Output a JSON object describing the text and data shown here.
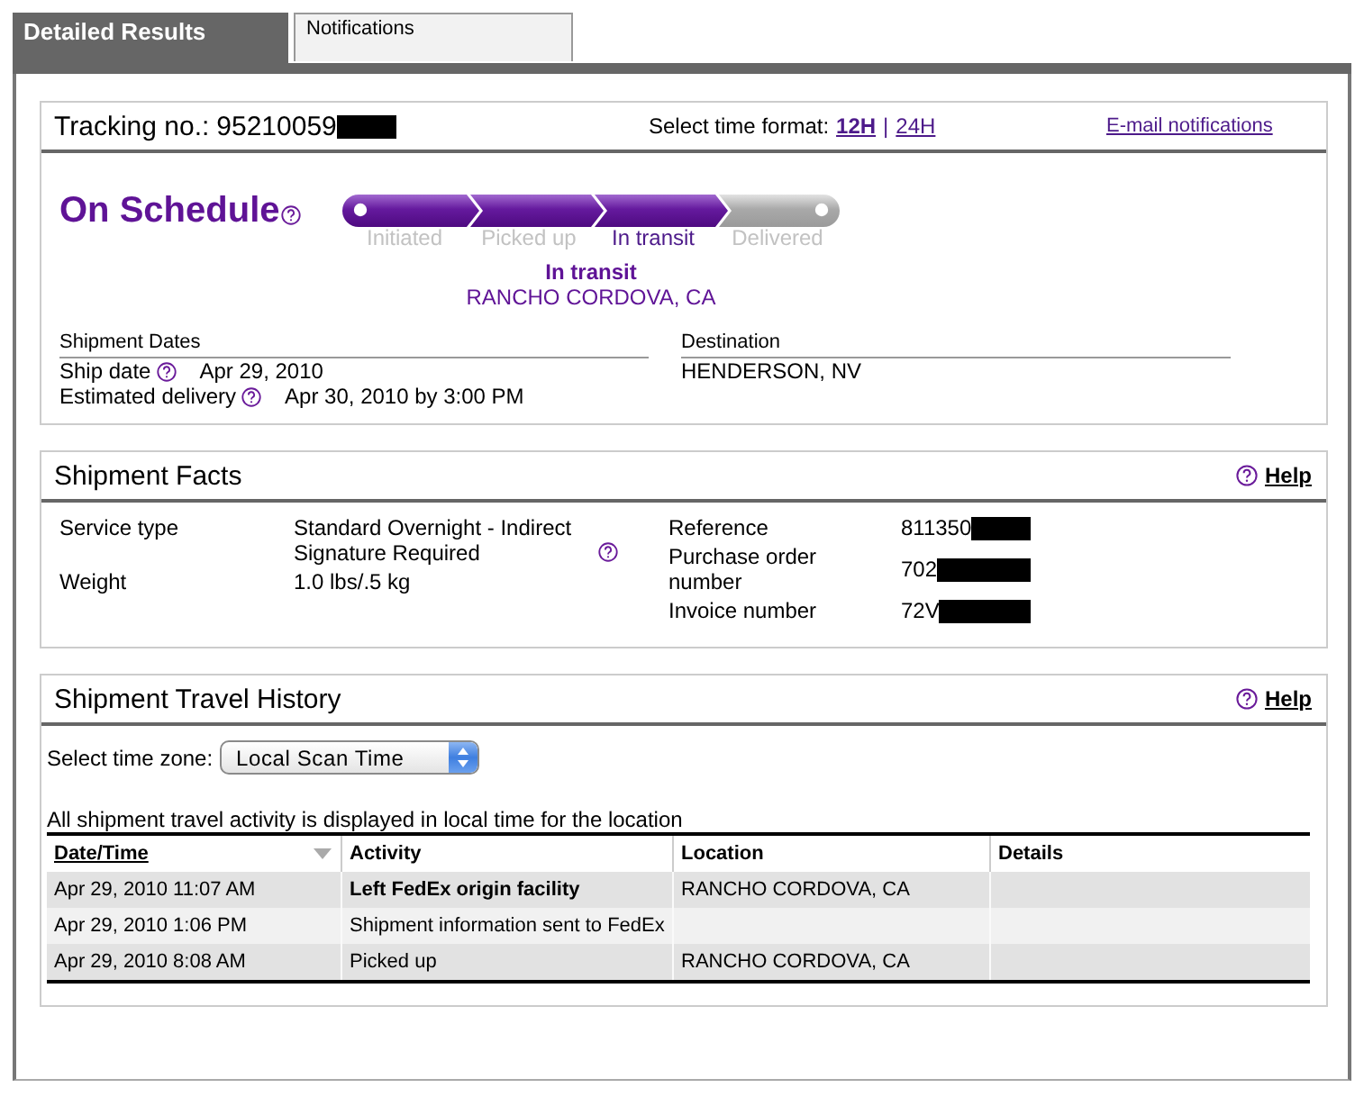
{
  "tabs": [
    {
      "label": "Detailed Results",
      "selected": true
    },
    {
      "label": "Notifications",
      "selected": false
    }
  ],
  "tracking": {
    "label": "Tracking no.:",
    "number": "95210059",
    "redacted": true,
    "time_format": {
      "label": "Select time format:",
      "options": [
        {
          "label": "12H",
          "selected": true
        },
        {
          "label": "24H",
          "selected": false
        }
      ],
      "separator": "|"
    },
    "email_link": "E-mail notifications"
  },
  "status": {
    "title": "On Schedule",
    "help": true,
    "steps": [
      {
        "label": "Initiated",
        "completed": true,
        "selected": false
      },
      {
        "label": "Picked up",
        "completed": true,
        "selected": false
      },
      {
        "label": "In transit",
        "completed": true,
        "selected": true
      },
      {
        "label": "Delivered",
        "completed": false,
        "selected": false
      }
    ],
    "current": {
      "status": "In transit",
      "location": "RANCHO CORDOVA, CA"
    }
  },
  "shipment_dates": {
    "heading": "Shipment Dates",
    "items": [
      {
        "label": "Ship date",
        "help": true,
        "value": "Apr 29, 2010"
      },
      {
        "label": "Estimated delivery",
        "help": true,
        "value": "Apr 30, 2010 by 3:00 PM"
      }
    ]
  },
  "destination": {
    "heading": "Destination",
    "value": "HENDERSON, NV"
  },
  "shipment_facts": {
    "title": "Shipment Facts",
    "help_link": "Help",
    "left": [
      {
        "label": "Service type",
        "value": "Standard Overnight - Indirect Signature Required",
        "help": true
      },
      {
        "label": "Weight",
        "value": "1.0 lbs/.5 kg",
        "help": false
      }
    ],
    "right": [
      {
        "label": "Reference",
        "value": "811350",
        "redacted": true
      },
      {
        "label": "Purchase order number",
        "value": "702",
        "redacted": true
      },
      {
        "label": "Invoice number",
        "value": "72V",
        "redacted": true
      }
    ]
  },
  "travel_history": {
    "title": "Shipment Travel History",
    "help_link": "Help",
    "time_zone": {
      "label": "Select time zone:",
      "value": "Local Scan Time"
    },
    "note": "All shipment travel activity is displayed in local time for the location",
    "table": {
      "columns": [
        {
          "label": "Date/Time",
          "sorted": true
        },
        {
          "label": "Activity",
          "sorted": false
        },
        {
          "label": "Location",
          "sorted": false
        },
        {
          "label": "Details",
          "sorted": false
        }
      ],
      "rows": [
        {
          "date_time": "Apr 29, 2010 11:07 AM",
          "activity": "Left FedEx origin facility",
          "location": "RANCHO CORDOVA, CA",
          "emphasized": true
        },
        {
          "date_time": "Apr 29, 2010 1:06 PM",
          "activity": "Shipment information sent to FedEx",
          "emphasized": false
        },
        {
          "date_time": "Apr 29, 2010 8:08 AM",
          "activity": "Picked up",
          "location": "RANCHO CORDOVA, CA",
          "emphasized": false
        }
      ]
    }
  }
}
